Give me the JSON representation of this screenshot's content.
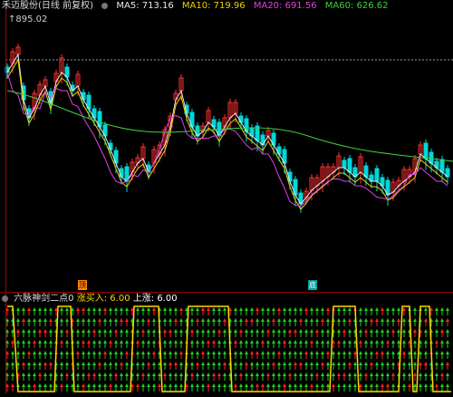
{
  "header": {
    "stock_title": "禾迈股份(日线 前复权)",
    "ma5": "MA5: 713.16",
    "ma10": "MA10: 719.96",
    "ma20": "MA20: 691.56",
    "ma60": "MA60: 626.62",
    "colors": {
      "ma5": "#e8e8e8",
      "ma10": "#f0d000",
      "ma20": "#e040e0",
      "ma60": "#40d040"
    }
  },
  "price_top_label": "895.02",
  "markers": {
    "m1": "顶",
    "m2": "底"
  },
  "indicator": {
    "title": "六脉神剑二点0",
    "buy_label": "涨买入: 6.00",
    "up_label": "上涨: 6.00"
  },
  "colors": {
    "up": "#ff3030",
    "down": "#00d8d8",
    "red_arrow": "#ff2020",
    "green_arrow": "#20d020",
    "yellow": "#ffd700"
  }
}
